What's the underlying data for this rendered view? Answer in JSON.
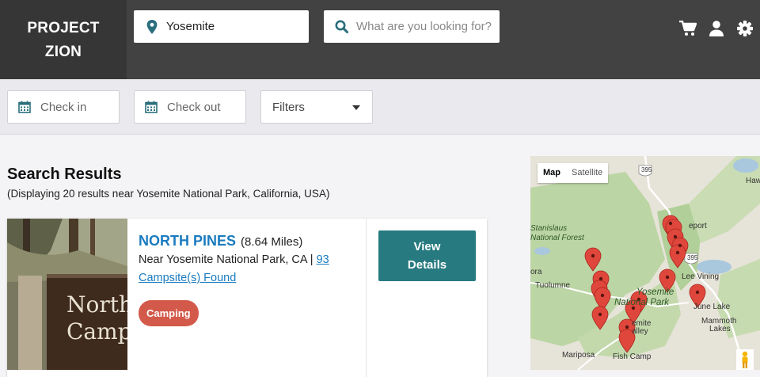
{
  "brand": {
    "line1": "PROJECT",
    "line2": "ZION"
  },
  "header": {
    "location_value": "Yosemite",
    "search_placeholder": "What are you looking for?",
    "icons": [
      "cart-icon",
      "user-icon",
      "gear-icon"
    ]
  },
  "filters": {
    "check_in_placeholder": "Check in",
    "check_out_placeholder": "Check out",
    "filters_label": "Filters"
  },
  "results": {
    "title": "Search Results",
    "subtitle": "(Displaying 20 results near Yosemite National Park, California, USA)"
  },
  "cards": [
    {
      "photo_sign_line1": "North",
      "photo_sign_line2": "Camp",
      "name": "NORTH PINES",
      "distance": "(8.64 Miles)",
      "near_prefix": "Near Yosemite National Park, CA |",
      "count_link_a": "93",
      "count_link_b": "Campsite(s) Found",
      "tag": "Camping",
      "button_line1": "View",
      "button_line2": "Details"
    }
  ],
  "map": {
    "toggle_map": "Map",
    "toggle_satellite": "Satellite",
    "labels": {
      "route395a": "395",
      "route395b": "395",
      "haw": "Haw",
      "bridgeport": "eport",
      "stanislaus1": "Stanislaus",
      "stanislaus2": "National Forest",
      "ora": "ora",
      "tuolumne": "Tuolumne",
      "lee_vining": "Lee Vining",
      "yosemite1": "Yosemite",
      "yosemite2": "National Park",
      "ite": "emite",
      "alley": "alley",
      "june_lake": "June Lake",
      "mammoth1": "Mammoth",
      "mammoth2": "Lakes",
      "mariposa": "Mariposa",
      "fish_camp": "Fish Camp"
    },
    "colors": {
      "park_green": "#b9d3a2",
      "lake_blue": "#a9c7dd",
      "marker_red": "#e0473c"
    }
  },
  "colors": {
    "header": "#424242",
    "accent_teal": "#277a80",
    "link_blue": "#1a7bbf",
    "tag_red": "#d35a4b"
  }
}
